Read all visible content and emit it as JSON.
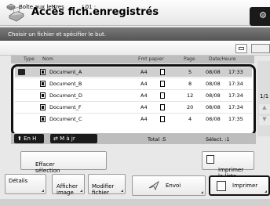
{
  "window": {
    "title": "Accès fich.enregistrés"
  },
  "instruction": "Choisir un fichier et spécifier le but.",
  "mailbox": {
    "label": "Boîte aux lettres",
    "number": "/ 01 :"
  },
  "columns": [
    "Type",
    "Nom",
    "Fmt papier",
    "Page",
    "Date/Heure"
  ],
  "files": [
    {
      "name": "Document_A",
      "format": "A4",
      "pages": "5",
      "date": "08/08",
      "time": "17:33",
      "selected": true
    },
    {
      "name": "Document_B",
      "format": "A4",
      "pages": "8",
      "date": "08/08",
      "time": "17:34",
      "selected": false
    },
    {
      "name": "Document_D",
      "format": "A4",
      "pages": "12",
      "date": "08/08",
      "time": "17:34",
      "selected": false
    },
    {
      "name": "Document_F",
      "format": "A4",
      "pages": "20",
      "date": "08/08",
      "time": "17:34",
      "selected": false
    },
    {
      "name": "Document_C",
      "format": "A4",
      "pages": "4",
      "date": "08/08",
      "time": "17:35",
      "selected": false
    }
  ],
  "pagination": {
    "indicator": "1/1"
  },
  "nav": {
    "top_label": "En H",
    "sort_label": "M à jr",
    "total_label": "Total :5",
    "selected_label": "Sélect. :1"
  },
  "actions": {
    "clear_label": "Effacer\nsélection",
    "print_list_label": "Imprimer\nla liste",
    "details_label": "Détails",
    "afficher_label": "Afficher\nimage",
    "modifier_label": "Modifier\nfichier",
    "send_label": "Envoi",
    "print_label": "Imprimer"
  },
  "icons": {
    "title": "scanner-icon",
    "mailbox": "mailbox-icon",
    "file": "document-file-icon",
    "page": "page-icon",
    "send": "send-icon",
    "print": "printer-icon"
  }
}
